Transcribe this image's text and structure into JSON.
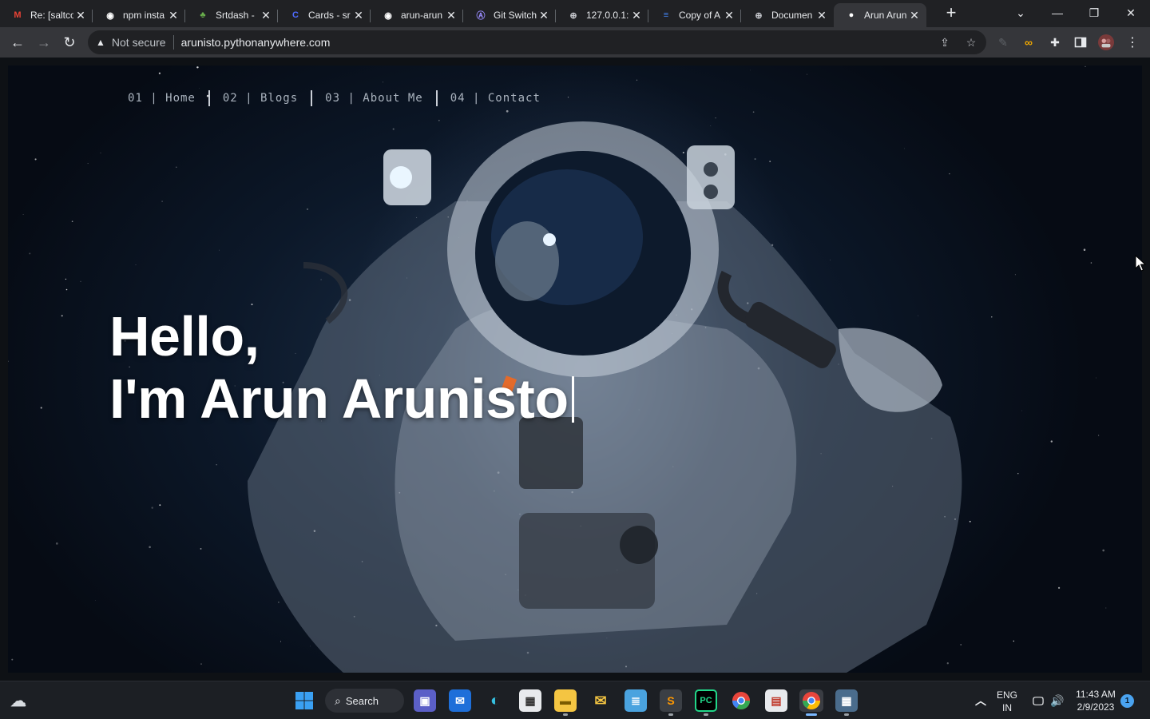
{
  "browser": {
    "tabs": [
      {
        "title": "Re: [saltco",
        "icon": "gmail-icon",
        "color": "#ea4335",
        "glyph": "M"
      },
      {
        "title": "npm insta",
        "icon": "github-icon",
        "color": "#ffffff",
        "glyph": "◉"
      },
      {
        "title": "Srtdash -",
        "icon": "leaf-icon",
        "color": "#6ab04c",
        "glyph": "♣"
      },
      {
        "title": "Cards - sr",
        "icon": "cards-c-icon",
        "color": "#4f6bff",
        "glyph": "C"
      },
      {
        "title": "arun-arun",
        "icon": "github-icon",
        "color": "#ffffff",
        "glyph": "◉"
      },
      {
        "title": "Git Switch",
        "icon": "git-switch-icon",
        "color": "#9a8cff",
        "glyph": "Ⓐ"
      },
      {
        "title": "127.0.0.1:",
        "icon": "globe-icon",
        "color": "#c8cacf",
        "glyph": "⊕"
      },
      {
        "title": "Copy of A",
        "icon": "google-docs-icon",
        "color": "#4285f4",
        "glyph": "≡"
      },
      {
        "title": "Documen",
        "icon": "globe-icon",
        "color": "#c8cacf",
        "glyph": "⊕"
      },
      {
        "title": "Arun Arun",
        "icon": "page-dot-icon",
        "color": "#ffffff",
        "glyph": "●"
      }
    ],
    "address": {
      "security_label": "Not secure",
      "url": "arunisto.pythonanywhere.com"
    }
  },
  "page": {
    "nav": [
      {
        "label": "01 | Home"
      },
      {
        "label": "02 | Blogs"
      },
      {
        "label": "03 | About Me"
      },
      {
        "label": "04 | Contact"
      }
    ],
    "hero": {
      "line1": "Hello,",
      "line2": "I'm Arun Arunisto"
    }
  },
  "taskbar": {
    "search_label": "Search",
    "language": "ENG",
    "region": "IN",
    "time": "11:43 AM",
    "date": "2/9/2023",
    "notification_count": "1"
  }
}
